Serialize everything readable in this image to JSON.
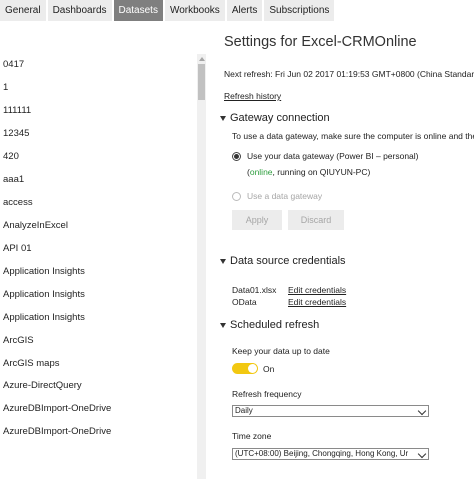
{
  "tabs": [
    {
      "label": "General",
      "active": false
    },
    {
      "label": "Dashboards",
      "active": false
    },
    {
      "label": "Datasets",
      "active": true
    },
    {
      "label": "Workbooks",
      "active": false
    },
    {
      "label": "Alerts",
      "active": false
    },
    {
      "label": "Subscriptions",
      "active": false
    }
  ],
  "datasets": [
    "0417",
    "1",
    "111111",
    "12345",
    "420",
    "aaa1",
    "access",
    "AnalyzeInExcel",
    "API 01",
    "Application Insights",
    "Application Insights",
    "Application Insights",
    "ArcGIS",
    "ArcGIS maps",
    "Azure-DirectQuery",
    "AzureDBImport-OneDrive",
    "AzureDBImport-OneDrive"
  ],
  "settings": {
    "title": "Settings for Excel-CRMOnline",
    "next_refresh": "Next refresh: Fri Jun 02 2017 01:19:53 GMT+0800 (China Standard",
    "refresh_history": "Refresh history",
    "gateway": {
      "header": "Gateway connection",
      "hint": "To use a data gateway, make sure the computer is online and the",
      "option_personal": "Use your data gateway (Power BI – personal)",
      "status_open": "(",
      "status_online": "online",
      "status_rest": ", running on QIUYUN-PC)",
      "option_data_gateway": "Use a data gateway",
      "apply": "Apply",
      "discard": "Discard"
    },
    "credentials": {
      "header": "Data source credentials",
      "rows": [
        {
          "source": "Data01.xlsx",
          "action": "Edit credentials"
        },
        {
          "source": "OData",
          "action": "Edit credentials"
        }
      ]
    },
    "schedule": {
      "header": "Scheduled refresh",
      "keep_label": "Keep your data up to date",
      "toggle_state": "On",
      "frequency_label": "Refresh frequency",
      "frequency_value": "Daily",
      "timezone_label": "Time zone",
      "timezone_value": "(UTC+08:00) Beijing, Chongqing, Hong Kong, Ur"
    }
  },
  "colors": {
    "active_tab": "#7f7f7f",
    "toggle_on": "#f2c811",
    "online": "#2e9e3e"
  }
}
